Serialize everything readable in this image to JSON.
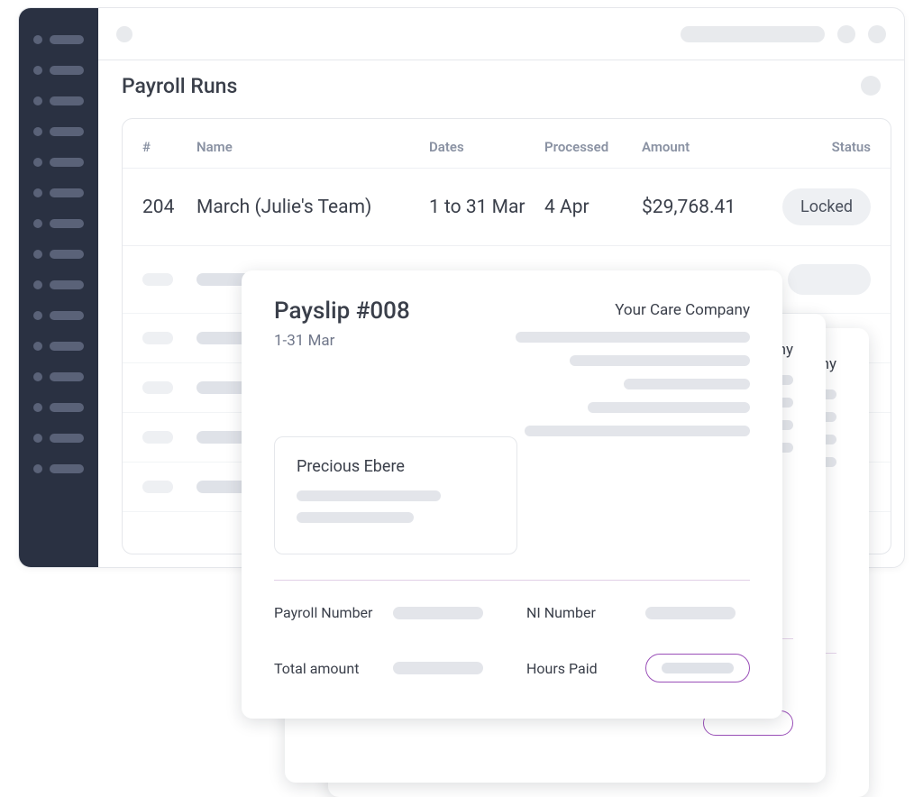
{
  "page": {
    "title": "Payroll Runs"
  },
  "table": {
    "columns": {
      "num": "#",
      "name": "Name",
      "dates": "Dates",
      "processed": "Processed",
      "amount": "Amount",
      "status": "Status"
    },
    "rows": [
      {
        "num": "204",
        "name": "March (Julie's Team)",
        "dates": "1 to 31 Mar",
        "processed": "4 Apr",
        "amount": "$29,768.41",
        "status": "Locked"
      }
    ]
  },
  "payslip": {
    "title": "Payslip #008",
    "date_range": "1-31 Mar",
    "company": "Your Care Company",
    "back_company_fragment": "ny",
    "employee": {
      "name": "Precious Ebere"
    },
    "details": {
      "payroll_number_label": "Payroll Number",
      "ni_number_label": "NI Number",
      "total_amount_label": "Total amount",
      "hours_paid_label": "Hours Paid"
    }
  }
}
